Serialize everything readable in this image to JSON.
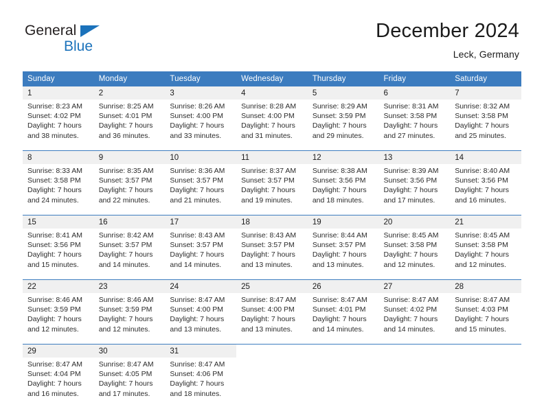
{
  "brand": {
    "name_part1": "General",
    "name_part2": "Blue",
    "triangle_icon": "triangle-icon"
  },
  "header": {
    "title": "December 2024",
    "subtitle": "Leck, Germany"
  },
  "weekday_headers": [
    "Sunday",
    "Monday",
    "Tuesday",
    "Wednesday",
    "Thursday",
    "Friday",
    "Saturday"
  ],
  "labels": {
    "sunrise_prefix": "Sunrise:",
    "sunset_prefix": "Sunset:",
    "daylight_prefix": "Daylight:"
  },
  "colors": {
    "header_blue": "#3c7cbf",
    "brand_blue": "#1b72bb",
    "daynum_band": "#f0f0f0",
    "text": "#1a1a1a"
  },
  "weeks": [
    [
      {
        "day": "1",
        "sunrise": "Sunrise: 8:23 AM",
        "sunset": "Sunset: 4:02 PM",
        "daylight_line1": "Daylight: 7 hours",
        "daylight_line2": "and 38 minutes."
      },
      {
        "day": "2",
        "sunrise": "Sunrise: 8:25 AM",
        "sunset": "Sunset: 4:01 PM",
        "daylight_line1": "Daylight: 7 hours",
        "daylight_line2": "and 36 minutes."
      },
      {
        "day": "3",
        "sunrise": "Sunrise: 8:26 AM",
        "sunset": "Sunset: 4:00 PM",
        "daylight_line1": "Daylight: 7 hours",
        "daylight_line2": "and 33 minutes."
      },
      {
        "day": "4",
        "sunrise": "Sunrise: 8:28 AM",
        "sunset": "Sunset: 4:00 PM",
        "daylight_line1": "Daylight: 7 hours",
        "daylight_line2": "and 31 minutes."
      },
      {
        "day": "5",
        "sunrise": "Sunrise: 8:29 AM",
        "sunset": "Sunset: 3:59 PM",
        "daylight_line1": "Daylight: 7 hours",
        "daylight_line2": "and 29 minutes."
      },
      {
        "day": "6",
        "sunrise": "Sunrise: 8:31 AM",
        "sunset": "Sunset: 3:58 PM",
        "daylight_line1": "Daylight: 7 hours",
        "daylight_line2": "and 27 minutes."
      },
      {
        "day": "7",
        "sunrise": "Sunrise: 8:32 AM",
        "sunset": "Sunset: 3:58 PM",
        "daylight_line1": "Daylight: 7 hours",
        "daylight_line2": "and 25 minutes."
      }
    ],
    [
      {
        "day": "8",
        "sunrise": "Sunrise: 8:33 AM",
        "sunset": "Sunset: 3:58 PM",
        "daylight_line1": "Daylight: 7 hours",
        "daylight_line2": "and 24 minutes."
      },
      {
        "day": "9",
        "sunrise": "Sunrise: 8:35 AM",
        "sunset": "Sunset: 3:57 PM",
        "daylight_line1": "Daylight: 7 hours",
        "daylight_line2": "and 22 minutes."
      },
      {
        "day": "10",
        "sunrise": "Sunrise: 8:36 AM",
        "sunset": "Sunset: 3:57 PM",
        "daylight_line1": "Daylight: 7 hours",
        "daylight_line2": "and 21 minutes."
      },
      {
        "day": "11",
        "sunrise": "Sunrise: 8:37 AM",
        "sunset": "Sunset: 3:57 PM",
        "daylight_line1": "Daylight: 7 hours",
        "daylight_line2": "and 19 minutes."
      },
      {
        "day": "12",
        "sunrise": "Sunrise: 8:38 AM",
        "sunset": "Sunset: 3:56 PM",
        "daylight_line1": "Daylight: 7 hours",
        "daylight_line2": "and 18 minutes."
      },
      {
        "day": "13",
        "sunrise": "Sunrise: 8:39 AM",
        "sunset": "Sunset: 3:56 PM",
        "daylight_line1": "Daylight: 7 hours",
        "daylight_line2": "and 17 minutes."
      },
      {
        "day": "14",
        "sunrise": "Sunrise: 8:40 AM",
        "sunset": "Sunset: 3:56 PM",
        "daylight_line1": "Daylight: 7 hours",
        "daylight_line2": "and 16 minutes."
      }
    ],
    [
      {
        "day": "15",
        "sunrise": "Sunrise: 8:41 AM",
        "sunset": "Sunset: 3:56 PM",
        "daylight_line1": "Daylight: 7 hours",
        "daylight_line2": "and 15 minutes."
      },
      {
        "day": "16",
        "sunrise": "Sunrise: 8:42 AM",
        "sunset": "Sunset: 3:57 PM",
        "daylight_line1": "Daylight: 7 hours",
        "daylight_line2": "and 14 minutes."
      },
      {
        "day": "17",
        "sunrise": "Sunrise: 8:43 AM",
        "sunset": "Sunset: 3:57 PM",
        "daylight_line1": "Daylight: 7 hours",
        "daylight_line2": "and 14 minutes."
      },
      {
        "day": "18",
        "sunrise": "Sunrise: 8:43 AM",
        "sunset": "Sunset: 3:57 PM",
        "daylight_line1": "Daylight: 7 hours",
        "daylight_line2": "and 13 minutes."
      },
      {
        "day": "19",
        "sunrise": "Sunrise: 8:44 AM",
        "sunset": "Sunset: 3:57 PM",
        "daylight_line1": "Daylight: 7 hours",
        "daylight_line2": "and 13 minutes."
      },
      {
        "day": "20",
        "sunrise": "Sunrise: 8:45 AM",
        "sunset": "Sunset: 3:58 PM",
        "daylight_line1": "Daylight: 7 hours",
        "daylight_line2": "and 12 minutes."
      },
      {
        "day": "21",
        "sunrise": "Sunrise: 8:45 AM",
        "sunset": "Sunset: 3:58 PM",
        "daylight_line1": "Daylight: 7 hours",
        "daylight_line2": "and 12 minutes."
      }
    ],
    [
      {
        "day": "22",
        "sunrise": "Sunrise: 8:46 AM",
        "sunset": "Sunset: 3:59 PM",
        "daylight_line1": "Daylight: 7 hours",
        "daylight_line2": "and 12 minutes."
      },
      {
        "day": "23",
        "sunrise": "Sunrise: 8:46 AM",
        "sunset": "Sunset: 3:59 PM",
        "daylight_line1": "Daylight: 7 hours",
        "daylight_line2": "and 12 minutes."
      },
      {
        "day": "24",
        "sunrise": "Sunrise: 8:47 AM",
        "sunset": "Sunset: 4:00 PM",
        "daylight_line1": "Daylight: 7 hours",
        "daylight_line2": "and 13 minutes."
      },
      {
        "day": "25",
        "sunrise": "Sunrise: 8:47 AM",
        "sunset": "Sunset: 4:00 PM",
        "daylight_line1": "Daylight: 7 hours",
        "daylight_line2": "and 13 minutes."
      },
      {
        "day": "26",
        "sunrise": "Sunrise: 8:47 AM",
        "sunset": "Sunset: 4:01 PM",
        "daylight_line1": "Daylight: 7 hours",
        "daylight_line2": "and 14 minutes."
      },
      {
        "day": "27",
        "sunrise": "Sunrise: 8:47 AM",
        "sunset": "Sunset: 4:02 PM",
        "daylight_line1": "Daylight: 7 hours",
        "daylight_line2": "and 14 minutes."
      },
      {
        "day": "28",
        "sunrise": "Sunrise: 8:47 AM",
        "sunset": "Sunset: 4:03 PM",
        "daylight_line1": "Daylight: 7 hours",
        "daylight_line2": "and 15 minutes."
      }
    ],
    [
      {
        "day": "29",
        "sunrise": "Sunrise: 8:47 AM",
        "sunset": "Sunset: 4:04 PM",
        "daylight_line1": "Daylight: 7 hours",
        "daylight_line2": "and 16 minutes."
      },
      {
        "day": "30",
        "sunrise": "Sunrise: 8:47 AM",
        "sunset": "Sunset: 4:05 PM",
        "daylight_line1": "Daylight: 7 hours",
        "daylight_line2": "and 17 minutes."
      },
      {
        "day": "31",
        "sunrise": "Sunrise: 8:47 AM",
        "sunset": "Sunset: 4:06 PM",
        "daylight_line1": "Daylight: 7 hours",
        "daylight_line2": "and 18 minutes."
      },
      {
        "day": "",
        "sunrise": "",
        "sunset": "",
        "daylight_line1": "",
        "daylight_line2": ""
      },
      {
        "day": "",
        "sunrise": "",
        "sunset": "",
        "daylight_line1": "",
        "daylight_line2": ""
      },
      {
        "day": "",
        "sunrise": "",
        "sunset": "",
        "daylight_line1": "",
        "daylight_line2": ""
      },
      {
        "day": "",
        "sunrise": "",
        "sunset": "",
        "daylight_line1": "",
        "daylight_line2": ""
      }
    ]
  ]
}
